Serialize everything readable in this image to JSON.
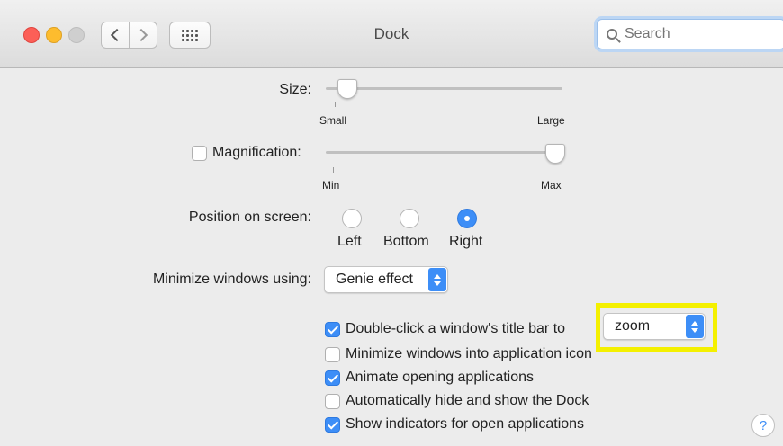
{
  "window": {
    "title": "Dock"
  },
  "search": {
    "placeholder": "Search"
  },
  "size": {
    "label": "Size:",
    "min_label": "Small",
    "max_label": "Large",
    "value": 0.1
  },
  "magnification": {
    "label": "Magnification:",
    "checked": false,
    "min_label": "Min",
    "max_label": "Max",
    "value": 0.98
  },
  "position": {
    "label": "Position on screen:",
    "options": [
      "Left",
      "Bottom",
      "Right"
    ],
    "selected": "Right"
  },
  "minimize": {
    "label": "Minimize windows using:",
    "value": "Genie effect"
  },
  "checkboxes": [
    {
      "label": "Double-click a window's title bar to",
      "checked": true
    },
    {
      "label": "Minimize windows into application icon",
      "checked": false
    },
    {
      "label": "Animate opening applications",
      "checked": true
    },
    {
      "label": "Automatically hide and show the Dock",
      "checked": false
    },
    {
      "label": "Show indicators for open applications",
      "checked": true
    }
  ],
  "double_click_action": {
    "value": "zoom"
  },
  "help": {
    "label": "?"
  },
  "colors": {
    "accent": "#3d8ef7",
    "highlight": "#f4f000"
  },
  "icons": [
    "close-button",
    "minimize-button",
    "zoom-button",
    "back-arrow",
    "forward-arrow",
    "grid-icon",
    "search-icon",
    "help-icon"
  ]
}
